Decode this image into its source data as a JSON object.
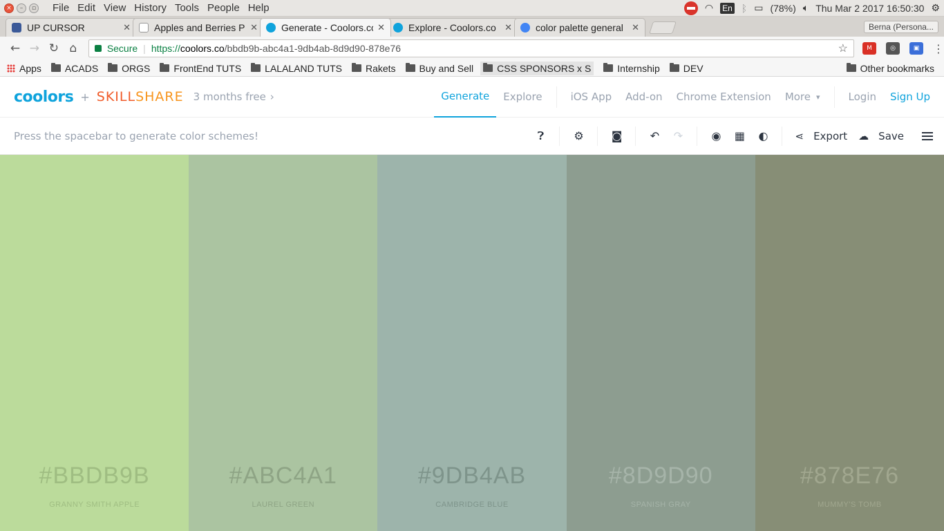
{
  "os": {
    "menu": [
      "File",
      "Edit",
      "View",
      "History",
      "Tools",
      "People",
      "Help"
    ],
    "battery": "(78%)",
    "datetime": "Thu Mar  2 2017 16:50:30",
    "lang": "En"
  },
  "tabs": [
    {
      "title": "UP CURSOR",
      "fav_color": "#3b5998",
      "active": false
    },
    {
      "title": "Apples and Berries P",
      "fav_color": "#bdbdbd",
      "active": false
    },
    {
      "title": "Generate - Coolors.co",
      "fav_color": "#0fa3dc",
      "active": true
    },
    {
      "title": "Explore - Coolors.co",
      "fav_color": "#0fa3dc",
      "active": false
    },
    {
      "title": "color palette general",
      "fav_color": "#4285f4",
      "active": false
    }
  ],
  "profile": "Berna (Persona...",
  "address": {
    "secure_label": "Secure",
    "scheme": "https://",
    "host": "coolors.co",
    "path": "/bbdb9b-abc4a1-9db4ab-8d9d90-878e76"
  },
  "bookmarks": {
    "apps": "Apps",
    "items": [
      "ACADS",
      "ORGS",
      "FrontEnd TUTS",
      "LALALAND TUTS",
      "Rakets",
      "Buy and Sell",
      "CSS SPONSORS x S",
      "Internship",
      "DEV"
    ],
    "other": "Other bookmarks"
  },
  "header": {
    "logo": "coolors",
    "plus": "+",
    "partner": "SKILLSHARE",
    "promo": "3 months free",
    "nav": {
      "generate": "Generate",
      "explore": "Explore",
      "ios": "iOS App",
      "addon": "Add-on",
      "chrome": "Chrome Extension",
      "more": "More",
      "login": "Login",
      "signup": "Sign Up"
    }
  },
  "toolbar": {
    "hint": "Press the spacebar to generate color schemes!",
    "export": "Export",
    "save": "Save"
  },
  "palette": [
    {
      "hex": "#BBDB9B",
      "name": "GRANNY SMITH APPLE",
      "color": "#bbdb9b",
      "text": "#9fbd82"
    },
    {
      "hex": "#ABC4A1",
      "name": "LAUREL GREEN",
      "color": "#abc4a1",
      "text": "#8ea485"
    },
    {
      "hex": "#9DB4AB",
      "name": "CAMBRIDGE BLUE",
      "color": "#9db4ab",
      "text": "#7e948b"
    },
    {
      "hex": "#8D9D90",
      "name": "SPANISH GRAY",
      "color": "#8d9d90",
      "text": "#a6b4a9"
    },
    {
      "hex": "#878E76",
      "name": "MUMMY'S TOMB",
      "color": "#878e76",
      "text": "#a1a78f"
    }
  ]
}
